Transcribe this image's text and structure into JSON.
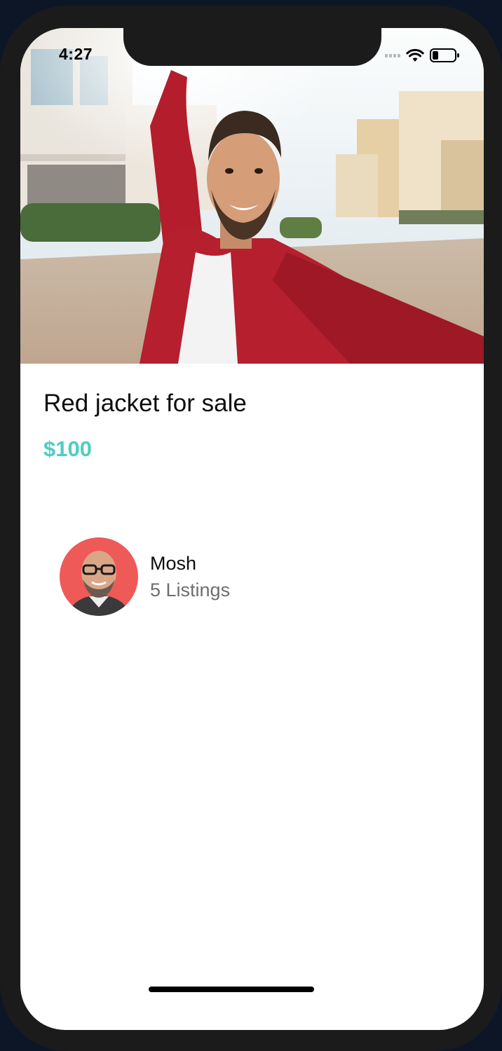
{
  "status_bar": {
    "time": "4:27",
    "icons": [
      "cellular-signal-icon",
      "wifi-icon",
      "battery-icon"
    ]
  },
  "listing": {
    "image": "man in red jacket taking selfie on street",
    "title": "Red jacket for sale",
    "price": "$100"
  },
  "seller": {
    "name": "Mosh",
    "listings": "5 Listings",
    "avatar": "profile photo of smiling bald man with glasses"
  },
  "colors": {
    "accent": "#4ecdc4",
    "title": "#0d0d0d",
    "subtitle": "#6e6e6e",
    "frame": "#1b1b1c"
  }
}
